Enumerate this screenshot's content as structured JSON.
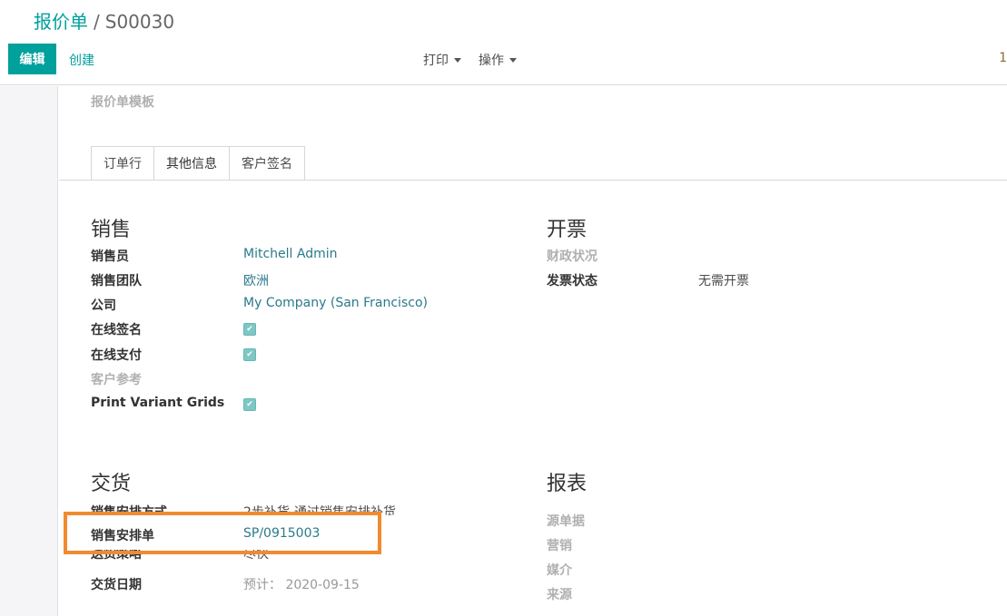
{
  "breadcrumb": {
    "parent": "报价单",
    "separator": "/",
    "current": "S00030"
  },
  "toolbar": {
    "edit_label": "编辑",
    "create_label": "创建",
    "print_label": "打印",
    "action_label": "操作",
    "pager": "1"
  },
  "form": {
    "template_label": "报价单模板",
    "tabs": [
      {
        "label": "订单行",
        "active": false
      },
      {
        "label": "其他信息",
        "active": true
      },
      {
        "label": "客户签名",
        "active": false
      }
    ],
    "sales": {
      "title": "销售",
      "salesperson_label": "销售员",
      "salesperson_value": "Mitchell Admin",
      "team_label": "销售团队",
      "team_value": "欧洲",
      "company_label": "公司",
      "company_value": "My Company (San Francisco)",
      "online_sign_label": "在线签名",
      "online_sign_checked": true,
      "online_pay_label": "在线支付",
      "online_pay_checked": true,
      "customer_ref_label": "客户参考",
      "print_variant_label": "Print Variant Grids",
      "print_variant_checked": true
    },
    "invoicing": {
      "title": "开票",
      "fiscal_label": "财政状况",
      "invoice_status_label": "发票状态",
      "invoice_status_value": "无需开票"
    },
    "delivery": {
      "title": "交货",
      "arrange_method_label": "销售安排方式",
      "arrange_method_value": "2步补货-通过销售安排补货",
      "arrange_order_label": "销售安排单",
      "arrange_order_value": "SP/0915003",
      "policy_label": "送货策略",
      "policy_value": "尽快",
      "date_label": "交货日期",
      "date_prefix": "预计：",
      "date_value": "2020-09-15"
    },
    "reporting": {
      "title": "报表",
      "source_label": "源单据",
      "campaign_label": "营销",
      "medium_label": "媒介",
      "source2_label": "来源"
    }
  },
  "colors": {
    "accent": "#00a09d",
    "highlight": "#f28a30"
  }
}
